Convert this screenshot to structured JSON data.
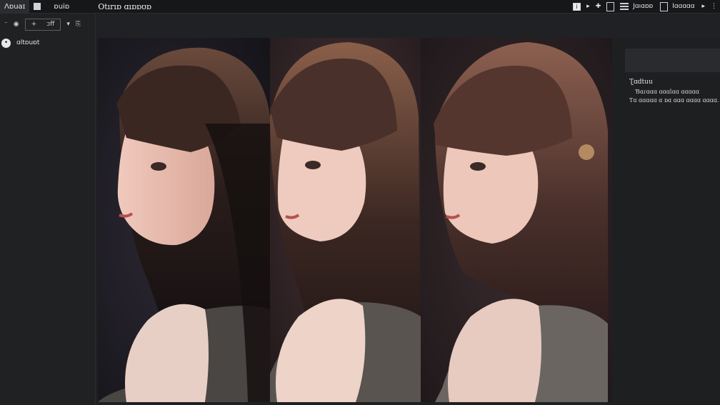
{
  "topbar": {
    "tab1": "Ʌɒuaɪ",
    "tab2": "ɒuiɒ",
    "title": "Otırıɒ ɑıɒɒʊɒ",
    "right_label1": "Jɑıɑɒɒ",
    "right_label2": "Iɑɑɑɑɑ"
  },
  "sidebar": {
    "toolbar_text": "ɔff",
    "item_label": "ɑltɒuɒt"
  },
  "right_panel": {
    "title": "Ʈɑdtuu",
    "line1": "Ɓɑɾɑɑɑ ɑɑɑlɑɑ ɑɑɑɑɑ",
    "line2": "Ƭɑ ɑɑɑɑɑ ɑ ɒɑ ɑɑɑ ɑɑɑɑ ɑɑɑɑ."
  },
  "colors": {
    "window_bg": "#1f2022",
    "topbar_bg": "#161719",
    "panel_bg": "#2a2b2e"
  },
  "gallery": {
    "images": [
      {
        "name": "portrait-1"
      },
      {
        "name": "portrait-2"
      },
      {
        "name": "portrait-3"
      }
    ]
  }
}
